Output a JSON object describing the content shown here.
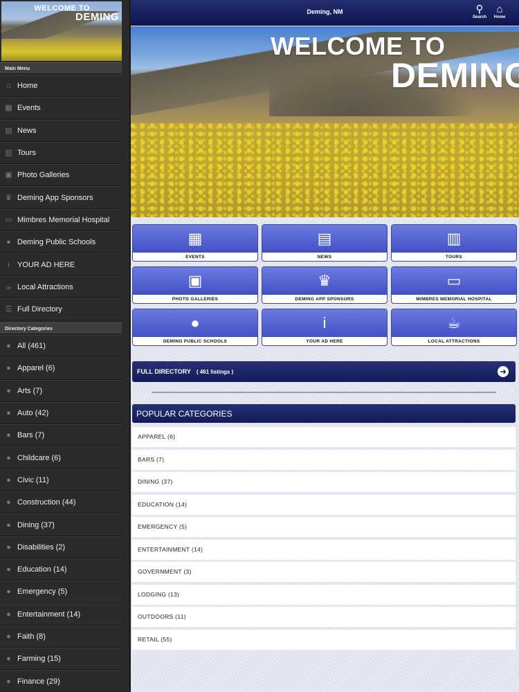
{
  "sidebar": {
    "banner": {
      "line1": "WELCOME TO",
      "line2": "DEMING"
    },
    "main_menu_header": "Main Menu",
    "main_menu": [
      {
        "label": "Home",
        "icon": "house-icon"
      },
      {
        "label": "Events",
        "icon": "calendar-icon"
      },
      {
        "label": "News",
        "icon": "newspaper-icon"
      },
      {
        "label": "Tours",
        "icon": "map-icon"
      },
      {
        "label": "Photo Galleries",
        "icon": "photo-icon"
      },
      {
        "label": "Deming App Sponsors",
        "icon": "crown-icon"
      },
      {
        "label": "Mimbres Memorial Hospital",
        "icon": "sign-icon"
      },
      {
        "label": "Deming Public Schools",
        "icon": "football-icon"
      },
      {
        "label": "YOUR AD HERE",
        "icon": "info-icon"
      },
      {
        "label": "Local Attractions",
        "icon": "drink-icon"
      },
      {
        "label": "Full Directory",
        "icon": "list-icon"
      }
    ],
    "directory_header": "Directory Categories",
    "directory": [
      "All (461)",
      "Apparel (6)",
      "Arts (7)",
      "Auto (42)",
      "Bars (7)",
      "Childcare (6)",
      "Civic (11)",
      "Construction (44)",
      "Dining (37)",
      "Disabilities (2)",
      "Education (14)",
      "Emergency (5)",
      "Entertainment (14)",
      "Faith (8)",
      "Farming (15)",
      "Finance (29)"
    ]
  },
  "topbar": {
    "title": "Deming, NM",
    "search_label": "Search",
    "home_label": "Home"
  },
  "hero": {
    "line1": "WELCOME TO",
    "line2": "DEMING"
  },
  "tiles": [
    {
      "label": "EVENTS",
      "icon": "calendar-icon"
    },
    {
      "label": "NEWS",
      "icon": "newspaper-icon"
    },
    {
      "label": "TOURS",
      "icon": "map-icon"
    },
    {
      "label": "PHOTO GALLERIES",
      "icon": "photo-icon"
    },
    {
      "label": "DEMING APP SPONSORS",
      "icon": "crown-icon"
    },
    {
      "label": "MIMBRES MEMORIAL HOSPITAL",
      "icon": "sign-icon"
    },
    {
      "label": "DEMING PUBLIC SCHOOLS",
      "icon": "football-icon"
    },
    {
      "label": "YOUR AD HERE",
      "icon": "info-icon"
    },
    {
      "label": "LOCAL ATTRACTIONS",
      "icon": "drink-icon"
    }
  ],
  "full_directory": {
    "label": "FULL DIRECTORY",
    "count": "( 461 listings )"
  },
  "popular": {
    "header": "POPULAR CATEGORIES",
    "items": [
      "APPAREL (6)",
      "BARS (7)",
      "DINING (37)",
      "EDUCATION (14)",
      "EMERGENCY (5)",
      "ENTERTAINMENT (14)",
      "GOVERNMENT (3)",
      "LODGING (13)",
      "OUTDOORS (11)",
      "RETAIL (55)"
    ]
  },
  "colors": {
    "nav_dark": "#121a58",
    "tile_blue": "#4f5ed0",
    "sidebar_bg": "#2b2b2b"
  }
}
